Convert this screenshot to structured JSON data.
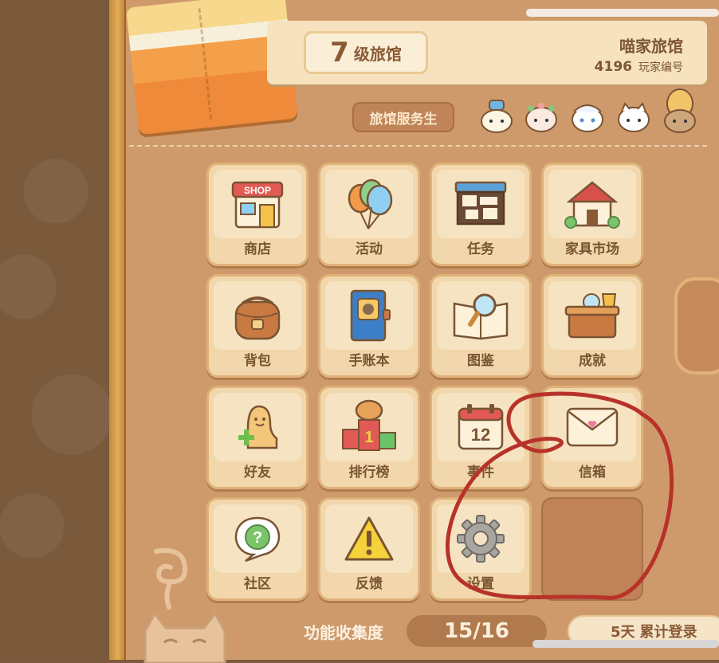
{
  "header": {
    "level_number": "7",
    "level_label": "级旅馆",
    "inn_name": "喵家旅馆",
    "player_id": "4196",
    "player_id_label": "玩家编号"
  },
  "service_button_label": "旅馆服务生",
  "menu": {
    "items": [
      {
        "label": "商店",
        "icon": "shop-icon"
      },
      {
        "label": "活动",
        "icon": "balloons-icon"
      },
      {
        "label": "任务",
        "icon": "task-board-icon"
      },
      {
        "label": "家具市场",
        "icon": "furniture-market-icon"
      },
      {
        "label": "背包",
        "icon": "backpack-icon"
      },
      {
        "label": "手账本",
        "icon": "journal-icon"
      },
      {
        "label": "图鉴",
        "icon": "encyclopedia-icon"
      },
      {
        "label": "成就",
        "icon": "trophy-chest-icon"
      },
      {
        "label": "好友",
        "icon": "add-friend-icon"
      },
      {
        "label": "排行榜",
        "icon": "leaderboard-icon"
      },
      {
        "label": "事件",
        "icon": "calendar-icon"
      },
      {
        "label": "信箱",
        "icon": "mail-icon"
      },
      {
        "label": "社区",
        "icon": "community-icon"
      },
      {
        "label": "反馈",
        "icon": "warning-icon"
      },
      {
        "label": "设置",
        "icon": "settings-gear-icon"
      }
    ],
    "calendar_day": "12",
    "shop_sign": "SHOP"
  },
  "footer": {
    "collection_label": "功能收集度",
    "collection_value": "15/16",
    "login_days": "5天",
    "login_label": "累计登录"
  },
  "colors": {
    "panel": "#cf9a6b",
    "tile": "#f1d7ab",
    "text_brown": "#7a5433",
    "annotation_red": "#b8322a"
  }
}
